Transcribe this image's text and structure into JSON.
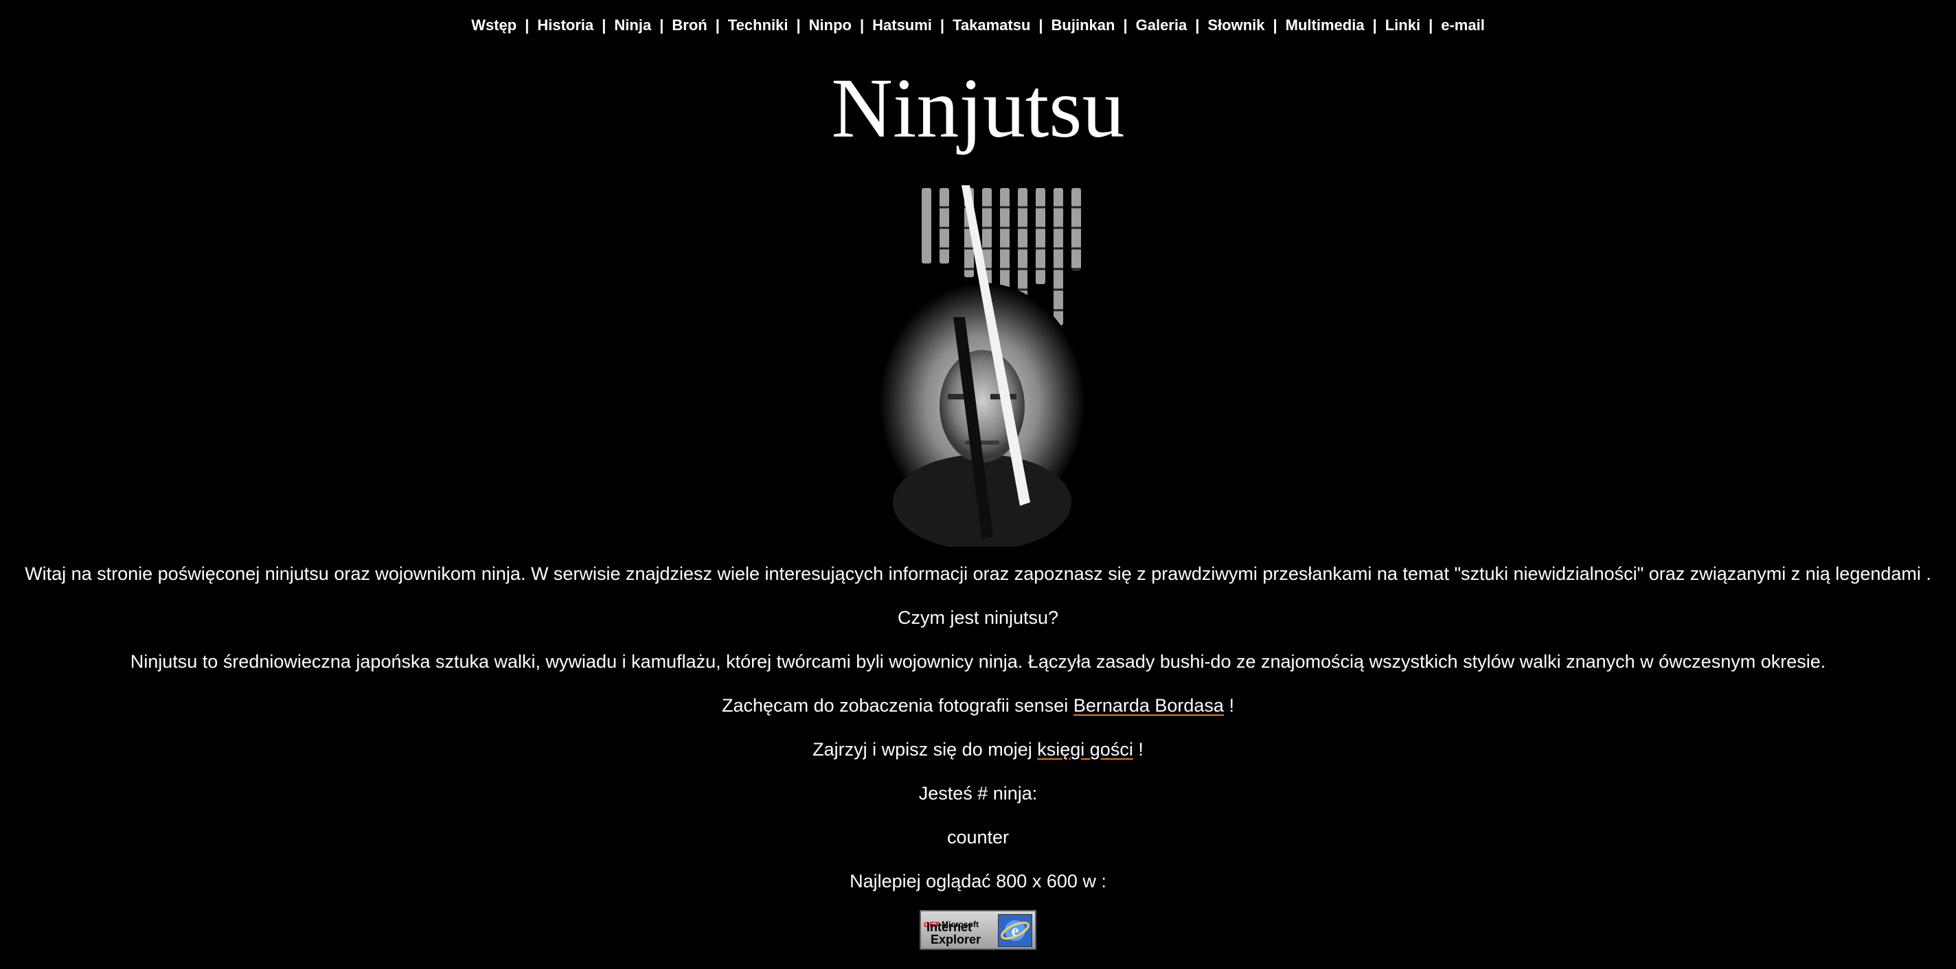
{
  "nav": {
    "items": [
      {
        "label": "Wstęp"
      },
      {
        "label": "Historia"
      },
      {
        "label": "Ninja"
      },
      {
        "label": "Broń"
      },
      {
        "label": "Techniki"
      },
      {
        "label": "Ninpo"
      },
      {
        "label": "Hatsumi"
      },
      {
        "label": "Takamatsu"
      },
      {
        "label": "Bujinkan"
      },
      {
        "label": "Galeria"
      },
      {
        "label": "Słownik"
      },
      {
        "label": "Multimedia"
      },
      {
        "label": "Linki"
      },
      {
        "label": "e-mail"
      }
    ],
    "separator": "|"
  },
  "title": "Ninjutsu",
  "content": {
    "intro": "Witaj na stronie poświęconej ninjutsu oraz wojownikom ninja. W serwisie znajdziesz wiele interesujących informacji oraz zapoznasz się z prawdziwymi przesłankami na temat \"sztuki niewidzialności\" oraz związanymi z nią legendami .",
    "question": "Czym jest ninjutsu?",
    "definition": "Ninjutsu to średniowieczna japońska sztuka walki, wywiadu i kamuflażu, której twórcami byli wojownicy ninja. Łączyła zasady bushi-do ze znajomością wszystkich stylów walki znanych w ówczesnym okresie.",
    "photos_prefix": "Zachęcam do zobaczenia fotografii sensei ",
    "photos_link": "Bernarda Bordasa",
    "photos_suffix": " !",
    "guestbook_prefix": "Zajrzyj i wpisz się do mojej ",
    "guestbook_link": "księgi gości",
    "guestbook_suffix": " !",
    "visitor_text": "Jesteś # ninja:",
    "counter": "counter",
    "best_view": "Najlepiej oglądać 800 x 600 w :"
  },
  "badge": {
    "get": "GET",
    "brand": "Microsoft",
    "line1": "Internet",
    "line2": "Explorer"
  },
  "colors": {
    "background": "#000000",
    "text": "#ffffff",
    "accent": "#ff8c1a"
  }
}
